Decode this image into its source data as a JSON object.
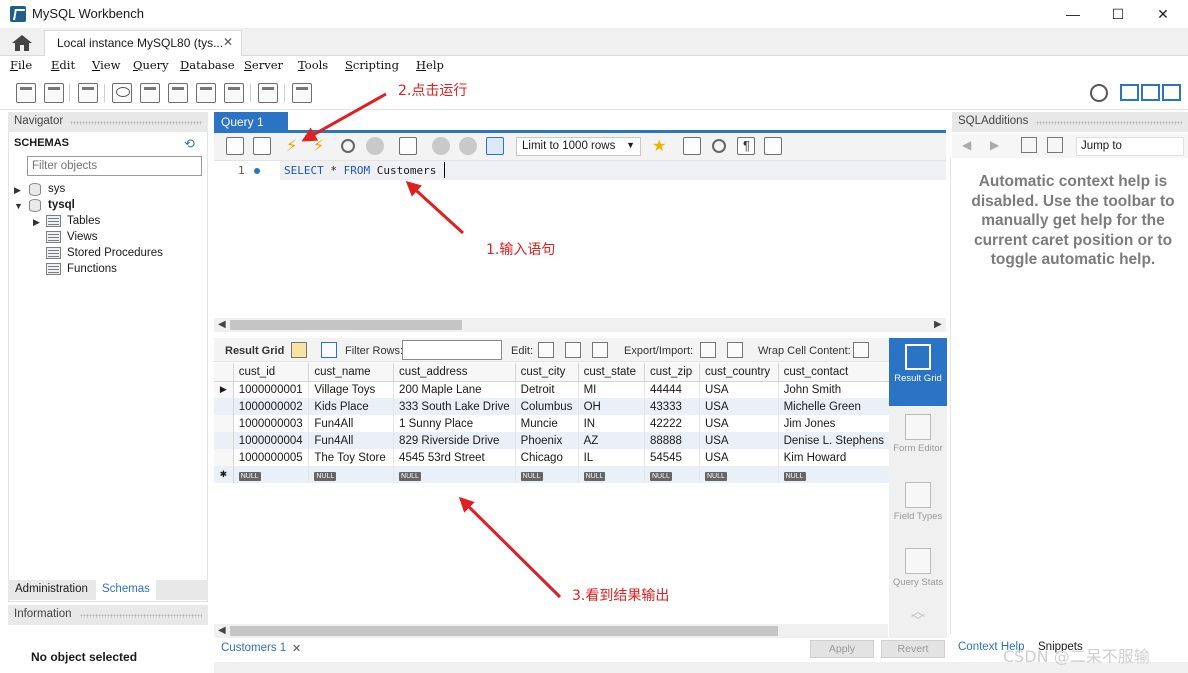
{
  "window": {
    "title": "MySQL Workbench",
    "controls": [
      "—",
      "☐",
      "✕"
    ]
  },
  "tabs": {
    "instance_label": "Local instance MySQL80 (tys...",
    "close": "✕"
  },
  "menu": [
    "File",
    "Edit",
    "View",
    "Query",
    "Database",
    "Server",
    "Tools",
    "Scripting",
    "Help"
  ],
  "navigator": {
    "title": "Navigator",
    "schemas_label": "SCHEMAS",
    "filter_placeholder": "Filter objects",
    "tree": {
      "sys": "sys",
      "tysql": "tysql",
      "tables": "Tables",
      "views": "Views",
      "procedures": "Stored Procedures",
      "functions": "Functions"
    },
    "tab_admin": "Administration",
    "tab_schemas": "Schemas",
    "info_title": "Information",
    "no_object": "No object selected"
  },
  "editor": {
    "tab": "Query 1",
    "limit": "Limit to 1000 rows",
    "line_number": "1",
    "query_kw1": "SELECT",
    "query_mid": " * ",
    "query_kw2": "FROM",
    "query_table": " Customers"
  },
  "result": {
    "grid_label": "Result Grid",
    "filter_label": "Filter Rows:",
    "edit_label": "Edit:",
    "export_label": "Export/Import:",
    "wrap_label": "Wrap Cell Content:",
    "columns": [
      "cust_id",
      "cust_name",
      "cust_address",
      "cust_city",
      "cust_state",
      "cust_zip",
      "cust_country",
      "cust_contact"
    ],
    "rows": [
      [
        "1000000001",
        "Village Toys",
        "200 Maple Lane",
        "Detroit",
        "MI",
        "44444",
        "USA",
        "John Smith"
      ],
      [
        "1000000002",
        "Kids Place",
        "333 South Lake Drive",
        "Columbus",
        "OH",
        "43333",
        "USA",
        "Michelle Green"
      ],
      [
        "1000000003",
        "Fun4All",
        "1 Sunny Place",
        "Muncie",
        "IN",
        "42222",
        "USA",
        "Jim Jones"
      ],
      [
        "1000000004",
        "Fun4All",
        "829 Riverside Drive",
        "Phoenix",
        "AZ",
        "88888",
        "USA",
        "Denise L. Stephens"
      ],
      [
        "1000000005",
        "The Toy Store",
        "4545 53rd Street",
        "Chicago",
        "IL",
        "54545",
        "USA",
        "Kim Howard"
      ]
    ],
    "null_tag": "NULL",
    "side": {
      "result_grid": "Result Grid",
      "form_editor": "Form Editor",
      "field_types": "Field Types",
      "query_stats": "Query Stats"
    },
    "results_tab": "Customers 1",
    "apply": "Apply",
    "revert": "Revert"
  },
  "sql_additions": {
    "title": "SQLAdditions",
    "jump_to": "Jump to",
    "help_text": "Automatic context help is disabled. Use the toolbar to manually get help for the current caret position or to toggle automatic help.",
    "tab_context": "Context Help",
    "tab_snippets": "Snippets"
  },
  "annotations": {
    "run": "2.点击运行",
    "input": "1.输入语句",
    "output": "3.看到结果输出"
  },
  "watermark": "CSDN @二呆不服输",
  "colors": {
    "accent": "#2b73c4",
    "annotation": "#e02020"
  }
}
